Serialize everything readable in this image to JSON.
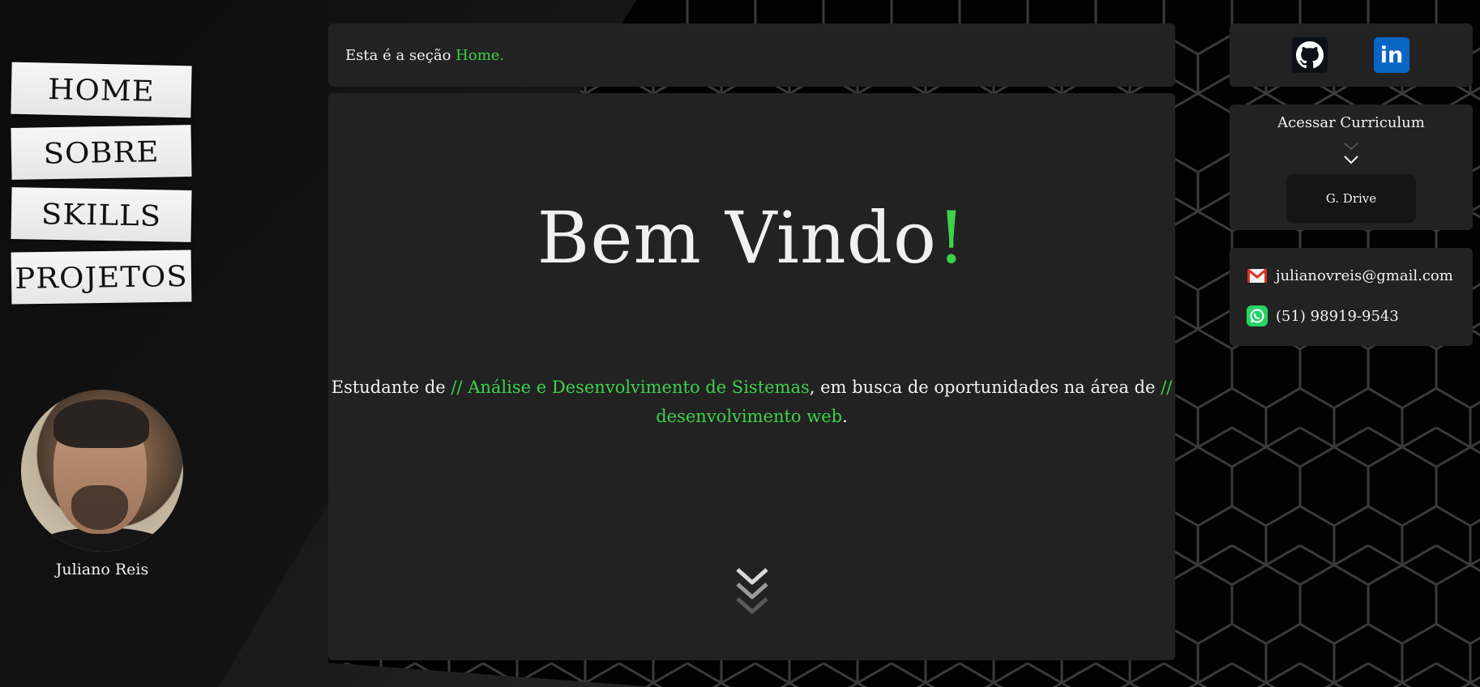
{
  "nav": {
    "items": [
      {
        "label": "HOME"
      },
      {
        "label": "SOBRE"
      },
      {
        "label": "SKILLS"
      },
      {
        "label": "PROJETOS"
      }
    ]
  },
  "profile": {
    "name": "Juliano Reis"
  },
  "header": {
    "prefix": "Esta é a seção",
    "section": "Home."
  },
  "hero": {
    "title": "Bem Vindo",
    "title_accent": "!",
    "desc_1": "Estudante de ",
    "desc_highlight_1": "// Análise e Desenvolvimento de Sistemas",
    "desc_2": ", em busca de oportunidades na área de ",
    "desc_highlight_2": "// desenvolvimento web",
    "desc_3": "."
  },
  "social": {
    "github_icon": "github-icon",
    "linkedin_icon": "linkedin-icon",
    "linkedin_glyph": "in"
  },
  "cv": {
    "title": "Acessar Curriculum",
    "button_label": "G. Drive"
  },
  "contact": {
    "email": "julianovreis@gmail.com",
    "phone": "(51) 98919-9543"
  },
  "colors": {
    "accent": "#3cd24a",
    "panel": "#222222",
    "background": "#050505"
  }
}
